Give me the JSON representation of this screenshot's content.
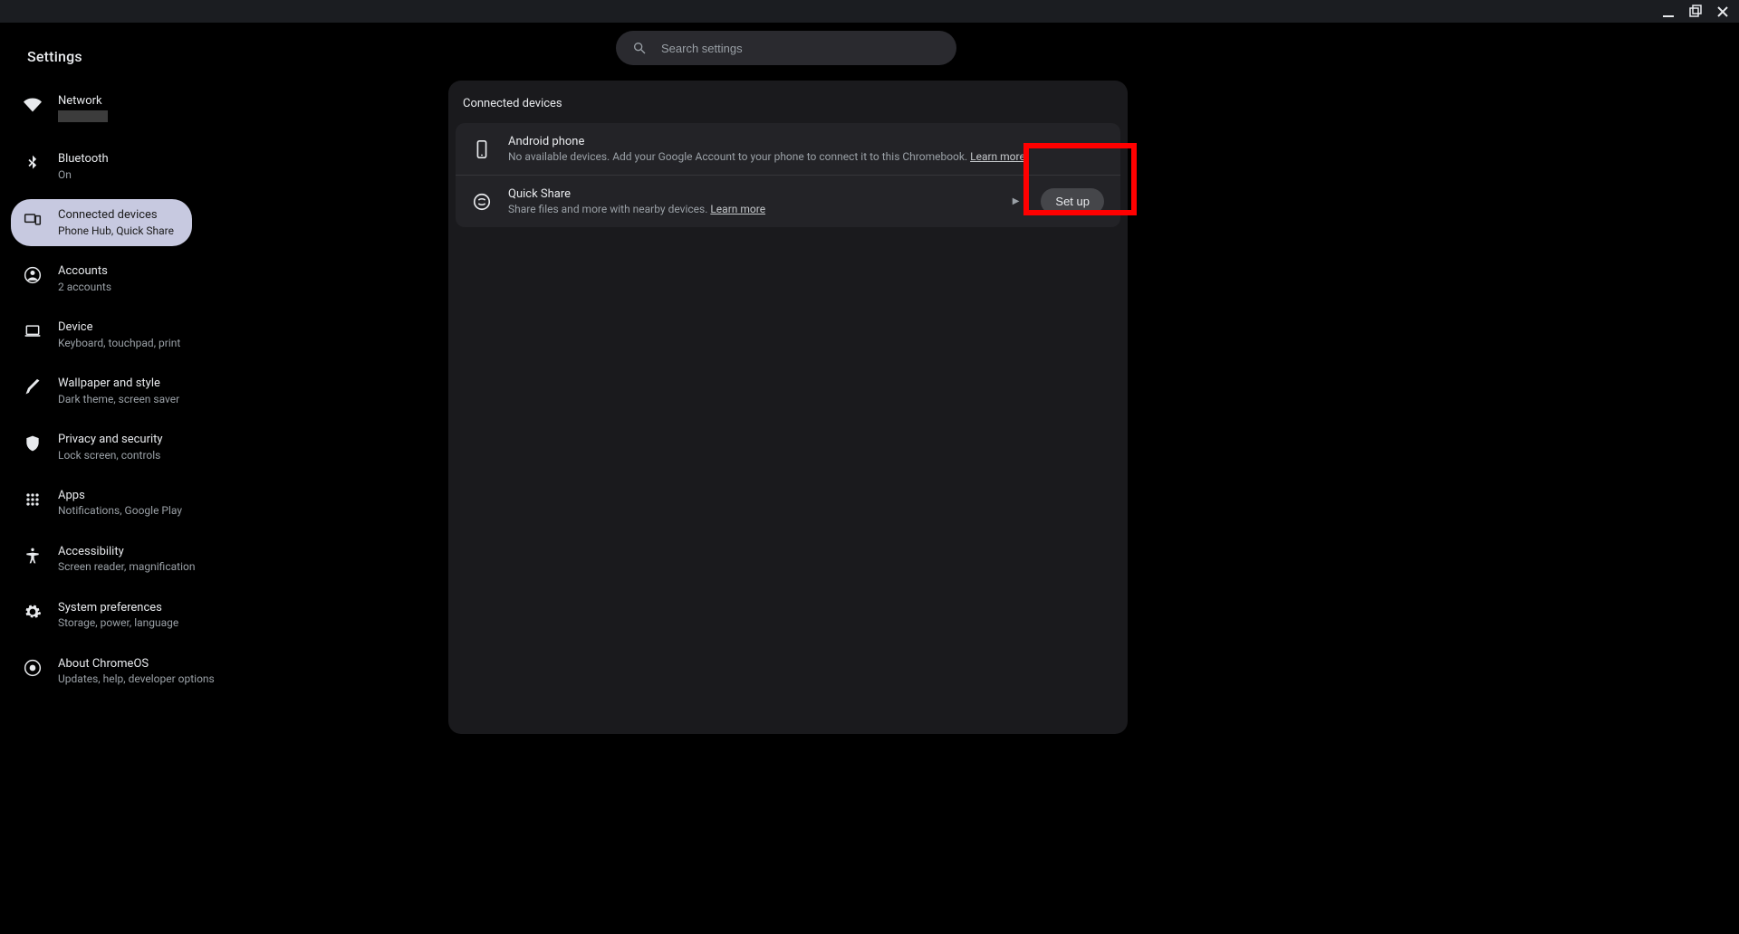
{
  "app": {
    "title": "Settings"
  },
  "search": {
    "placeholder": "Search settings"
  },
  "sidebar": {
    "items": [
      {
        "label": "Network",
        "sub": "",
        "redacted_sub": true
      },
      {
        "label": "Bluetooth",
        "sub": "On"
      },
      {
        "label": "Connected devices",
        "sub": "Phone Hub, Quick Share"
      },
      {
        "label": "Accounts",
        "sub": "2 accounts"
      },
      {
        "label": "Device",
        "sub": "Keyboard, touchpad, print"
      },
      {
        "label": "Wallpaper and style",
        "sub": "Dark theme, screen saver"
      },
      {
        "label": "Privacy and security",
        "sub": "Lock screen, controls"
      },
      {
        "label": "Apps",
        "sub": "Notifications, Google Play"
      },
      {
        "label": "Accessibility",
        "sub": "Screen reader, magnification"
      },
      {
        "label": "System preferences",
        "sub": "Storage, power, language"
      },
      {
        "label": "About ChromeOS",
        "sub": "Updates, help, developer options"
      }
    ],
    "active_index": 2
  },
  "main": {
    "section_title": "Connected devices",
    "rows": [
      {
        "title": "Android phone",
        "desc": "No available devices. Add your Google Account to your phone to connect it to this Chromebook. ",
        "learn_more": "Learn more"
      },
      {
        "title": "Quick Share",
        "desc": "Share files and more with nearby devices. ",
        "learn_more": "Learn more",
        "action_label": "Set up"
      }
    ]
  },
  "highlight": {
    "target": "set-up-button"
  }
}
